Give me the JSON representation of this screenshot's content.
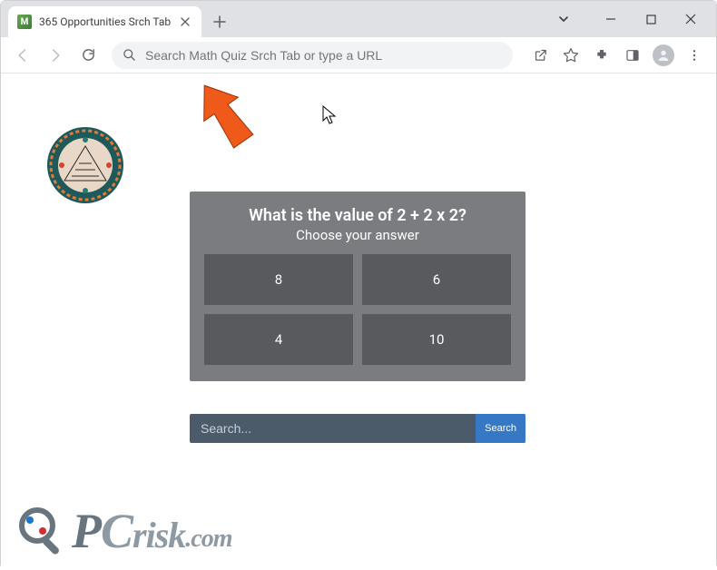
{
  "window": {
    "tab_title": "365 Opportunities Srch Tab",
    "favicon_letter": "M"
  },
  "toolbar": {
    "omnibox_placeholder": "Search Math Quiz Srch Tab or type a URL"
  },
  "quiz": {
    "question": "What is the value of 2 + 2 x 2?",
    "subtitle": "Choose your answer",
    "answers": [
      "8",
      "6",
      "4",
      "10"
    ]
  },
  "search": {
    "placeholder": "Search...",
    "button": "Search"
  },
  "watermark": {
    "p": "P",
    "c": "C",
    "risk": "risk",
    "com": ".com"
  }
}
